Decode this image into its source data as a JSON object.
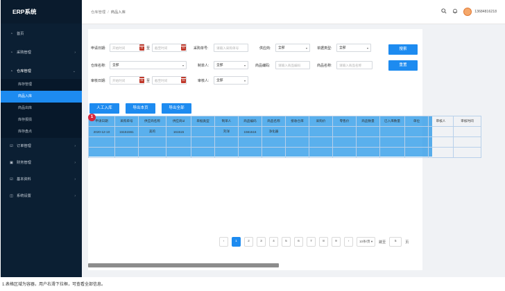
{
  "app": {
    "title": "ERP系统"
  },
  "sidebar": {
    "items": [
      {
        "label": "首页",
        "icon": "dashboard-icon",
        "arrow": ""
      },
      {
        "label": "采购管理",
        "icon": "cart-icon",
        "arrow": "›"
      },
      {
        "label": "仓库管理",
        "icon": "warehouse-icon",
        "arrow": "⌄"
      },
      {
        "label": "订单管理",
        "icon": "order-icon",
        "arrow": "›"
      },
      {
        "label": "财务管理",
        "icon": "finance-icon",
        "arrow": "›"
      },
      {
        "label": "基本资料",
        "icon": "profile-icon",
        "arrow": "›"
      },
      {
        "label": "系统设置",
        "icon": "settings-icon",
        "arrow": "›"
      }
    ],
    "sub_items": [
      "库存管理",
      "商品入库",
      "商品出库",
      "库存报损",
      "库存盘点"
    ],
    "active_sub": "商品入库"
  },
  "header": {
    "breadcrumb": [
      "仓库管理",
      "商品入库"
    ],
    "breadcrumb_sep": "/",
    "phone": "13684816218"
  },
  "filters": {
    "apply_date_label": "申请日期:",
    "start_placeholder": "开始时间",
    "to_label": "至",
    "end_placeholder": "截至时间",
    "purchase_no_label": "采购单号:",
    "purchase_no_placeholder": "请输入采购单号",
    "supplier_label": "供应商:",
    "supplier_value": "全部",
    "doc_type_label": "单据类型:",
    "doc_type_value": "全部",
    "warehouse_label": "仓库名称:",
    "warehouse_value": "全部",
    "creator_label": "制单人:",
    "creator_value": "全部",
    "product_code_label": "商品编码:",
    "product_code_placeholder": "请输入商品编码",
    "product_name_label": "商品名称:",
    "product_name_placeholder": "请输入商品名称",
    "review_date_label": "审核日期:",
    "reviewer_label": "审核人:",
    "reviewer_value": "全部",
    "calendar_day": "31"
  },
  "actions": {
    "search": "搜索",
    "reset": "重置",
    "manual_in": "人工入库",
    "export_page": "导出本页",
    "export_all": "导出全部"
  },
  "table": {
    "columns": [
      "申请日期",
      "采购单号",
      "供应商名称",
      "供应商id",
      "单据类型",
      "制单人",
      "商品编码",
      "商品名称",
      "接收仓库",
      "采购价",
      "零售价",
      "商品数量",
      "已入库数量",
      "单位",
      "审核人",
      "审核时间"
    ],
    "rows": [
      [
        "2020-12-10",
        "15151561",
        "美的",
        "161515",
        "",
        "刘洋",
        "1561516",
        "净化器",
        "",
        "",
        "",
        "",
        "",
        "",
        "",
        ""
      ],
      [
        "",
        "",
        "",
        "",
        "",
        "",
        "",
        "",
        "",
        "",
        "",
        "",
        "",
        "",
        "",
        ""
      ],
      [
        "",
        "",
        "",
        "",
        "",
        "",
        "",
        "",
        "",
        "",
        "",
        "",
        "",
        "",
        "",
        ""
      ]
    ]
  },
  "annotation": {
    "marker": "1"
  },
  "pagination": {
    "pages": [
      "1",
      "2",
      "3",
      "4",
      "5",
      "6",
      "7",
      "8",
      "9"
    ],
    "active": "1",
    "prev": "‹",
    "next": "›",
    "page_size": "10条/页",
    "goto_label": "跳至",
    "goto_value": "5",
    "page_suffix": "页"
  },
  "footnote": "1.表格区域为容器，用户右滑下拉框，可查看全部信息。"
}
